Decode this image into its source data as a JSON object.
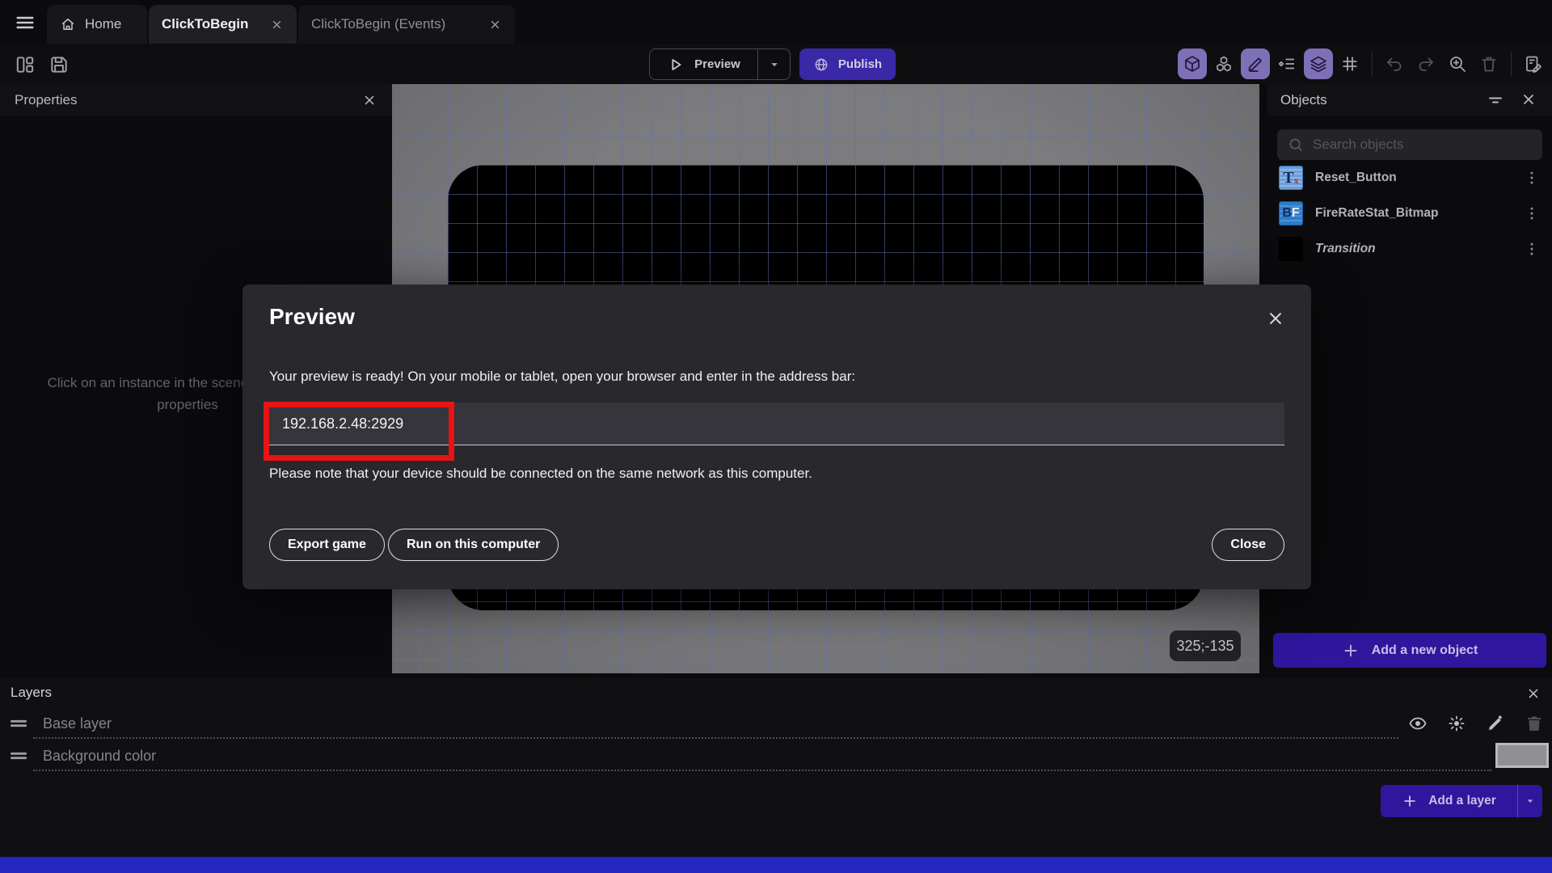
{
  "tabbar": {
    "home_tab": "Home",
    "scene_tab": "ClickToBegin",
    "events_tab": "ClickToBegin (Events)"
  },
  "toolbar": {
    "preview_label": "Preview",
    "publish_label": "Publish"
  },
  "properties_panel": {
    "title": "Properties",
    "empty_message_line1": "Click on an instance in the scene to display its",
    "empty_message_line2": "properties"
  },
  "canvas": {
    "coordinates_badge": "325;-135"
  },
  "objects_panel": {
    "title": "Objects",
    "search_placeholder": "Search objects",
    "items": [
      {
        "name": "Reset_Button",
        "icon_main": "T",
        "icon_sub": "x"
      },
      {
        "name": "FireRateStat_Bitmap",
        "icon_main": "B",
        "icon_sub": "F"
      },
      {
        "name": "Transition"
      }
    ],
    "add_button_label": "Add a new object"
  },
  "preview_dialog": {
    "title": "Preview",
    "body": "Your preview is ready! On your mobile or tablet, open your browser and enter in the address bar:",
    "address": "192.168.2.48:2929",
    "note": "Please note that your device should be connected on the same network as this computer.",
    "export_button": "Export game",
    "run_button": "Run on this computer",
    "close_button": "Close"
  },
  "layers_panel": {
    "title": "Layers",
    "layers": [
      {
        "name": "Base layer"
      },
      {
        "name": "Background color"
      }
    ],
    "add_button_label": "Add a layer"
  },
  "colors": {
    "publish_accent": "#3a28a6",
    "add_accent": "#2f169d",
    "annotation_red": "#e81313",
    "background_color_swatch": "#8f8f94",
    "canvas_grid": "#6070b0"
  }
}
